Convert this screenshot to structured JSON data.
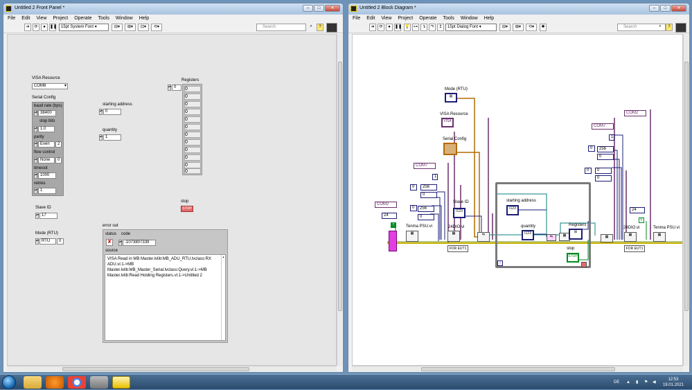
{
  "front_panel": {
    "title": "Untitled 2 Front Panel *",
    "menu": [
      "File",
      "Edit",
      "View",
      "Project",
      "Operate",
      "Tools",
      "Window",
      "Help"
    ],
    "font": "15pt System Font",
    "search_placeholder": "Search",
    "visa_resource_label": "VISA Resource",
    "visa_resource_value": "COM8",
    "serial_config_label": "Serial Config",
    "baud_label": "baud rate (bps)",
    "baud_value": "38400",
    "stop_bits_label": "stop bits",
    "stop_bits_value": "1.0",
    "parity_label": "parity",
    "parity_value": "Even",
    "parity_num": "2",
    "flow_label": "flow control",
    "flow_value": "None",
    "flow_num": "0",
    "timeout_label": "timeout",
    "timeout_value": "1000",
    "retries_label": "retries",
    "retries_value": "1",
    "slave_id_label": "Slave ID",
    "slave_id_value": "17",
    "mode_label": "Mode (RTU)",
    "mode_value": "RTU",
    "mode_num": "0",
    "starting_address_label": "starting address",
    "starting_address_value": "0",
    "quantity_label": "quantity",
    "quantity_value": "1",
    "registers_label": "Registers",
    "registers_index": "0",
    "registers_values": [
      "0",
      "0",
      "0",
      "0",
      "0",
      "0",
      "0",
      "0",
      "0",
      "0",
      "0",
      "0"
    ],
    "stop_label": "stop",
    "stop_button": "STOP",
    "error_out_label": "error out",
    "status_label": "status",
    "code_label": "code",
    "code_value": "-1073807339",
    "source_label": "source",
    "source_text": "VISA Read in MB Master.lvlib:MB_ADU_RTU.lvclass:RX ADU.vi:1->MB Master.lvlib:MB_Master_Serial.lvclass:Query.vi:1->MB Master.lvlib:Read Holding Registers.vi:1->Untitled 2"
  },
  "block_diagram": {
    "title": "Untitled 2 Block Diagram *",
    "menu": [
      "File",
      "Edit",
      "View",
      "Project",
      "Operate",
      "Tools",
      "Window",
      "Help"
    ],
    "font": "15pt Dialog Font",
    "search_placeholder": "Search",
    "mode_label": "Mode (RTU)",
    "visa_label": "VISA Resource",
    "serial_label": "Serial Config",
    "slave_label": "Slave ID",
    "start_addr_label": "starting address",
    "quantity_label": "quantity",
    "registers_label": "Registers",
    "stop_label": "stop",
    "com7_left": "COM7",
    "com2_left": "COM2",
    "com7_right": "COM7",
    "com2_right": "COM2",
    "c256a": "256",
    "c256b": "256",
    "c256c": "256",
    "c0": "0",
    "c1": "1",
    "c24a": "24",
    "c24b": "24",
    "tenma_left": "Tenma PSU.vi",
    "tenma_right": "Tenma PSU.vi",
    "d24_left": "24DIO.vi",
    "d24_right": "24DIO.vi",
    "for_eut_left": "FOR EUT1",
    "for_eut_right": "FOR EUT1",
    "i123": "I123",
    "iter": "i",
    "true_const": "T",
    "false_const": "F",
    "visa_term": "VISA"
  },
  "taskbar": {
    "lang": "DE",
    "time": "12:53",
    "date": "19.01.2021"
  }
}
